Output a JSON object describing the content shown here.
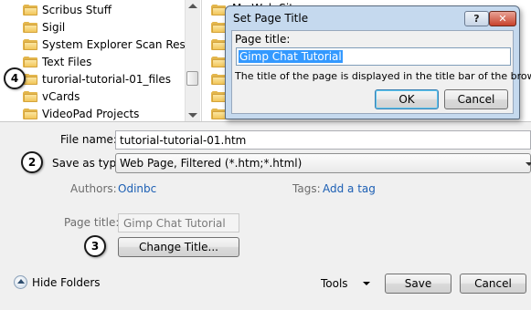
{
  "folders_left": [
    {
      "label": "Scribus Stuff"
    },
    {
      "label": "Sigil"
    },
    {
      "label": "System Explorer Scan Results_"
    },
    {
      "label": "Text Files"
    },
    {
      "label": "turorial-tutorial-01_files"
    },
    {
      "label": "vCards"
    },
    {
      "label": "VideoPad Projects"
    }
  ],
  "folders_right_partial": {
    "label": "My Web Sites"
  },
  "dialog": {
    "title": "Set Page Title",
    "help_glyph": "?",
    "close_glyph": "✕",
    "field_label": "Page title:",
    "field_value": "Gimp Chat Tutorial",
    "description": "The title of the page is displayed in the title bar of the browser.",
    "ok_label": "OK",
    "cancel_label": "Cancel"
  },
  "form": {
    "file_name_label": "File name:",
    "file_name_value": "tutorial-tutorial-01.htm",
    "save_as_type_label": "Save as type:",
    "save_as_type_value": "Web Page, Filtered (*.htm;*.html)",
    "authors_label": "Authors:",
    "authors_value": "Odinbc",
    "tags_label": "Tags:",
    "tags_value": "Add a tag",
    "page_title_label": "Page title:",
    "page_title_value": "Gimp Chat Tutorial",
    "change_title_label": "Change Title..."
  },
  "footer": {
    "hide_folders_label": "Hide Folders",
    "tools_label": "Tools",
    "save_label": "Save",
    "cancel_label": "Cancel"
  },
  "callouts": {
    "c2": "2",
    "c3": "3",
    "c4": "4"
  },
  "colors": {
    "link": "#1c5fb4",
    "selection": "#3399ff",
    "dialog_frame": "#c5d9ee",
    "close_button": "#c7422c"
  }
}
